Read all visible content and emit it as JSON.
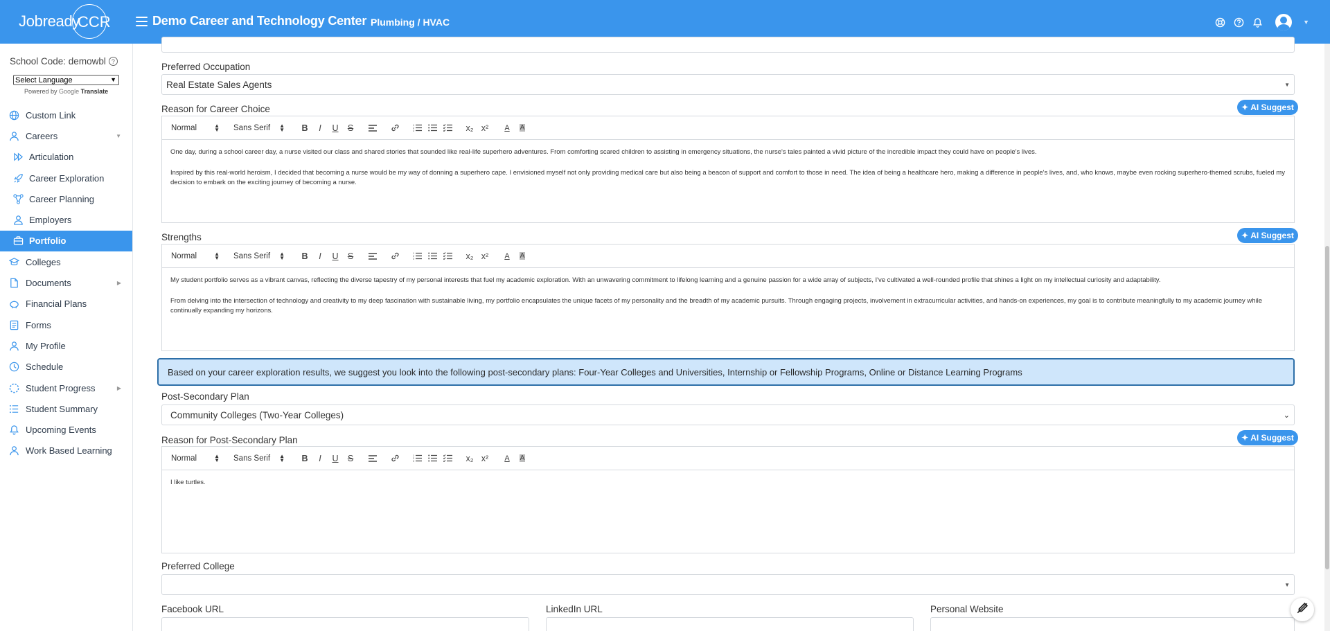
{
  "header": {
    "logo_text": "Jobready",
    "logo_ccr": "CCR",
    "org_title": "Demo Career and Technology Center",
    "program": "Plumbing / HVAC",
    "icons": [
      "support-icon",
      "help-icon",
      "bell-icon",
      "user-avatar-icon"
    ]
  },
  "sidebar": {
    "school_code": "School Code: demowbl",
    "language_select": "Select Language",
    "powered_by": "Powered by",
    "google": "Google",
    "translate": "Translate",
    "items": [
      {
        "label": "Custom Link",
        "icon": "globe-icon"
      },
      {
        "label": "Careers",
        "icon": "user-icon"
      },
      {
        "label": "Articulation",
        "icon": "articulation-icon"
      },
      {
        "label": "Career Exploration",
        "icon": "rocket-icon"
      },
      {
        "label": "Career Planning",
        "icon": "flowchart-icon"
      },
      {
        "label": "Employers",
        "icon": "person-icon"
      },
      {
        "label": "Portfolio",
        "icon": "briefcase-icon"
      },
      {
        "label": "Colleges",
        "icon": "college-icon"
      },
      {
        "label": "Documents",
        "icon": "document-icon"
      },
      {
        "label": "Financial Plans",
        "icon": "piggy-bank-icon"
      },
      {
        "label": "Forms",
        "icon": "form-icon"
      },
      {
        "label": "My Profile",
        "icon": "profile-icon"
      },
      {
        "label": "Schedule",
        "icon": "clock-icon"
      },
      {
        "label": "Student Progress",
        "icon": "progress-icon"
      },
      {
        "label": "Student Summary",
        "icon": "list-icon"
      },
      {
        "label": "Upcoming Events",
        "icon": "bell-icon"
      },
      {
        "label": "Work Based Learning",
        "icon": "worker-icon"
      }
    ]
  },
  "form": {
    "preferred_occupation_label": "Preferred Occupation",
    "preferred_occupation_value": "Real Estate Sales Agents",
    "reason_career_label": "Reason for Career Choice",
    "ai_suggest": "AI Suggest",
    "toolbar": {
      "heading": "Normal",
      "font": "Sans Serif",
      "bold": "B",
      "italic": "I",
      "underline": "U",
      "strike": "S",
      "sub": "x₂",
      "sup": "x²",
      "color": "A",
      "bg": "A"
    },
    "reason_career_p1": "One day, during a school career day, a nurse visited our class and shared stories that sounded like real-life superhero adventures. From comforting scared children to assisting in emergency situations, the nurse's tales painted a vivid picture of the incredible impact they could have on people's lives.",
    "reason_career_p2": "Inspired by this real-world heroism, I decided that becoming a nurse would be my way of donning a superhero cape. I envisioned myself not only providing medical care but also being a beacon of support and comfort to those in need. The idea of being a healthcare hero, making a difference in people's lives, and, who knows, maybe even rocking superhero-themed scrubs, fueled my decision to embark on the exciting journey of becoming a nurse.",
    "strengths_label": "Strengths",
    "strengths_p1": "My student portfolio serves as a vibrant canvas, reflecting the diverse tapestry of my personal interests that fuel my academic exploration. With an unwavering commitment to lifelong learning and a genuine passion for a wide array of subjects, I've cultivated a well-rounded profile that shines a light on my intellectual curiosity and adaptability.",
    "strengths_p2": "From delving into the intersection of technology and creativity to my deep fascination with sustainable living, my portfolio encapsulates the unique facets of my personality and the breadth of my academic pursuits. Through engaging projects, involvement in extracurricular activities, and hands-on experiences, my goal is to contribute meaningfully to my academic journey while continually expanding my horizons.",
    "suggestion": "Based on your career exploration results, we suggest you look into the following post-secondary plans: Four-Year Colleges and Universities, Internship or Fellowship Programs, Online or Distance Learning Programs",
    "post_secondary_label": "Post-Secondary Plan",
    "post_secondary_value": "Community Colleges (Two-Year Colleges)",
    "reason_post_label": "Reason for Post-Secondary Plan",
    "reason_post_text": "I like turtles.",
    "preferred_college_label": "Preferred College",
    "preferred_college_value": "",
    "facebook_label": "Facebook URL",
    "linkedin_label": "LinkedIn URL",
    "website_label": "Personal Website"
  },
  "colors": {
    "brand": "#3a95ec",
    "suggestion_bg": "#cfe6fb",
    "suggestion_border": "#2d6fa8"
  }
}
